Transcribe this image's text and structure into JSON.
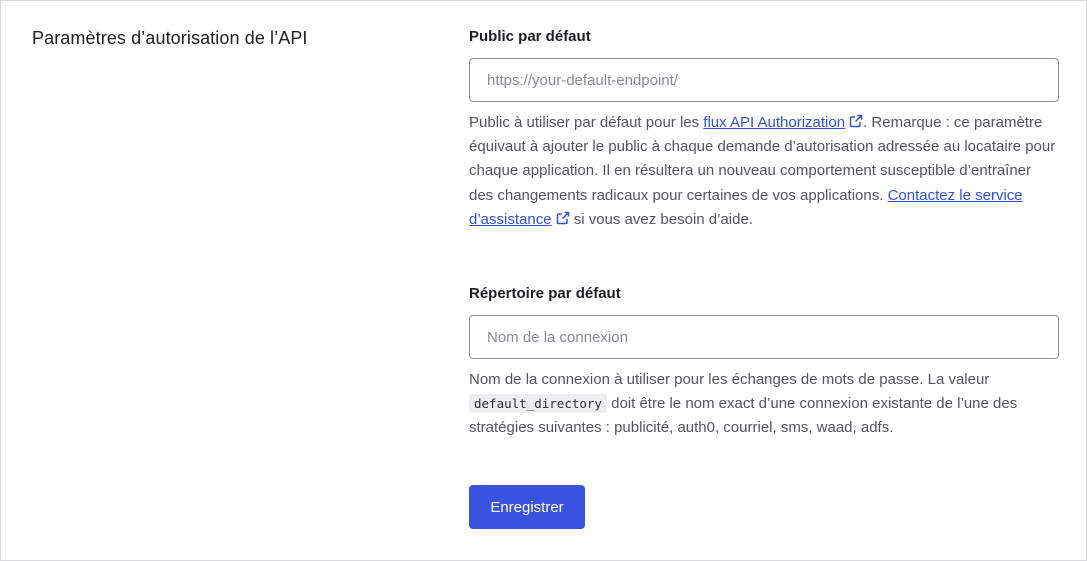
{
  "section": {
    "title": "Paramètres d’autorisation de l’API"
  },
  "audience": {
    "label": "Public par défaut",
    "placeholder": "https://your-default-endpoint/",
    "value": "",
    "help_before": "Public à utiliser par défaut pour les ",
    "link1": "flux API Authorization",
    "help_middle": ". Remarque : ce paramètre équivaut à ajouter le public à chaque demande d’autorisation adressée au locataire pour chaque application. Il en résultera un nouveau comportement susceptible d’entraîner des changements radicaux pour certaines de vos applications. ",
    "link2": "Contactez le service d’assistance",
    "help_after": " si vous avez besoin d’aide."
  },
  "directory": {
    "label": "Répertoire par défaut",
    "placeholder": "Nom de la connexion",
    "value": "",
    "help_before": "Nom de la connexion à utiliser pour les échanges de mots de passe. La valeur ",
    "code": "default_directory",
    "help_after": " doit être le nom exact d’une connexion existante de l’une des stratégies suivantes : publicité, auth0, courriel, sms, waad, adfs."
  },
  "actions": {
    "save_label": "Enregistrer"
  },
  "colors": {
    "accent": "#3a52e0",
    "link": "#3150e0"
  },
  "icons": {
    "external_link": "external-link-icon"
  }
}
